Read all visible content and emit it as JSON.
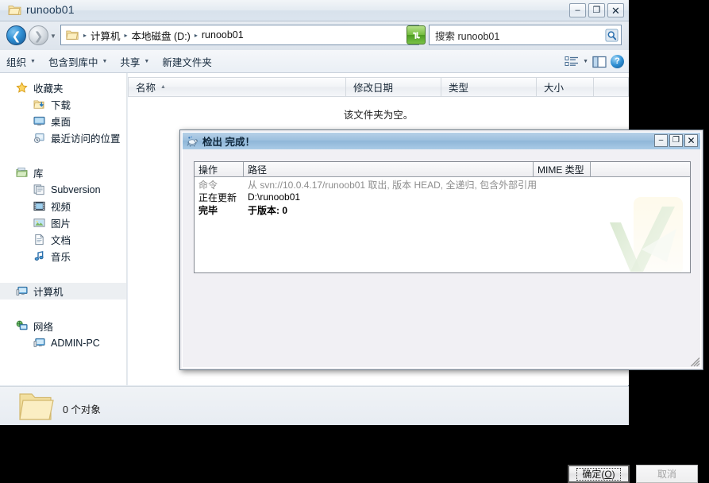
{
  "explorer": {
    "title": "runoob01",
    "window_buttons": {
      "minimize": "–",
      "maximize": "❐",
      "close": "✕"
    },
    "address": {
      "crumbs": [
        "计算机",
        "本地磁盘 (D:)",
        "runoob01"
      ],
      "separator": "▸",
      "dropdown": "▼",
      "go_label": "↻"
    },
    "search": {
      "placeholder": "搜索 runoob01",
      "icon": "search-icon"
    },
    "toolbar": {
      "items": [
        {
          "label": "组织",
          "caret": "▼"
        },
        {
          "label": "包含到库中",
          "caret": "▼"
        },
        {
          "label": "共享",
          "caret": "▼"
        },
        {
          "label": "新建文件夹",
          "caret": ""
        }
      ],
      "view_caret": "▼",
      "help_label": "?"
    },
    "nav_pane": {
      "groups": [
        {
          "header": {
            "label": "收藏夹",
            "icon": "star-icon"
          },
          "items": [
            {
              "label": "下载",
              "icon": "downloads-icon"
            },
            {
              "label": "桌面",
              "icon": "desktop-icon"
            },
            {
              "label": "最近访问的位置",
              "icon": "recent-places-icon"
            }
          ]
        },
        {
          "header": {
            "label": "库",
            "icon": "library-icon"
          },
          "items": [
            {
              "label": "Subversion",
              "icon": "subversion-library-icon"
            },
            {
              "label": "视频",
              "icon": "video-icon"
            },
            {
              "label": "图片",
              "icon": "pictures-icon"
            },
            {
              "label": "文档",
              "icon": "documents-icon"
            },
            {
              "label": "音乐",
              "icon": "music-icon"
            }
          ]
        },
        {
          "header": {
            "label": "计算机",
            "icon": "computer-icon",
            "selected": true
          },
          "items": []
        },
        {
          "header": {
            "label": "网络",
            "icon": "network-icon"
          },
          "items": [
            {
              "label": "ADMIN-PC",
              "icon": "computer-icon"
            }
          ]
        }
      ]
    },
    "file_list": {
      "columns": [
        {
          "label": "名称",
          "sort": "▲"
        },
        {
          "label": "修改日期",
          "sort": ""
        },
        {
          "label": "类型",
          "sort": ""
        },
        {
          "label": "大小",
          "sort": ""
        }
      ],
      "empty_message": "该文件夹为空。",
      "rows": []
    },
    "status_bar": {
      "text": "0 个对象",
      "icon": "folder-icon"
    }
  },
  "dialog": {
    "title": "检出 完成！",
    "icon": "tortoise-svn-icon",
    "window_buttons": {
      "minimize": "–",
      "maximize": "❐",
      "close": "✕"
    },
    "log": {
      "columns": [
        {
          "label": "操作"
        },
        {
          "label": "路径"
        },
        {
          "label": "MIME 类型"
        },
        {
          "label": ""
        }
      ],
      "rows": [
        {
          "action": "命令",
          "path": "从 svn://10.0.4.17/runoob01 取出, 版本 HEAD, 全递归, 包含外部引用",
          "style": "gray"
        },
        {
          "action": "正在更新",
          "path": "D:\\runoob01",
          "style": "normal"
        },
        {
          "action": "完毕",
          "path": "于版本: 0",
          "style": "bold"
        }
      ]
    },
    "buttons": {
      "ok": {
        "prefix": "确定(",
        "accesskey": "O",
        "suffix": ")",
        "focused": true
      },
      "cancel": {
        "label": "取消",
        "disabled": true
      }
    }
  }
}
